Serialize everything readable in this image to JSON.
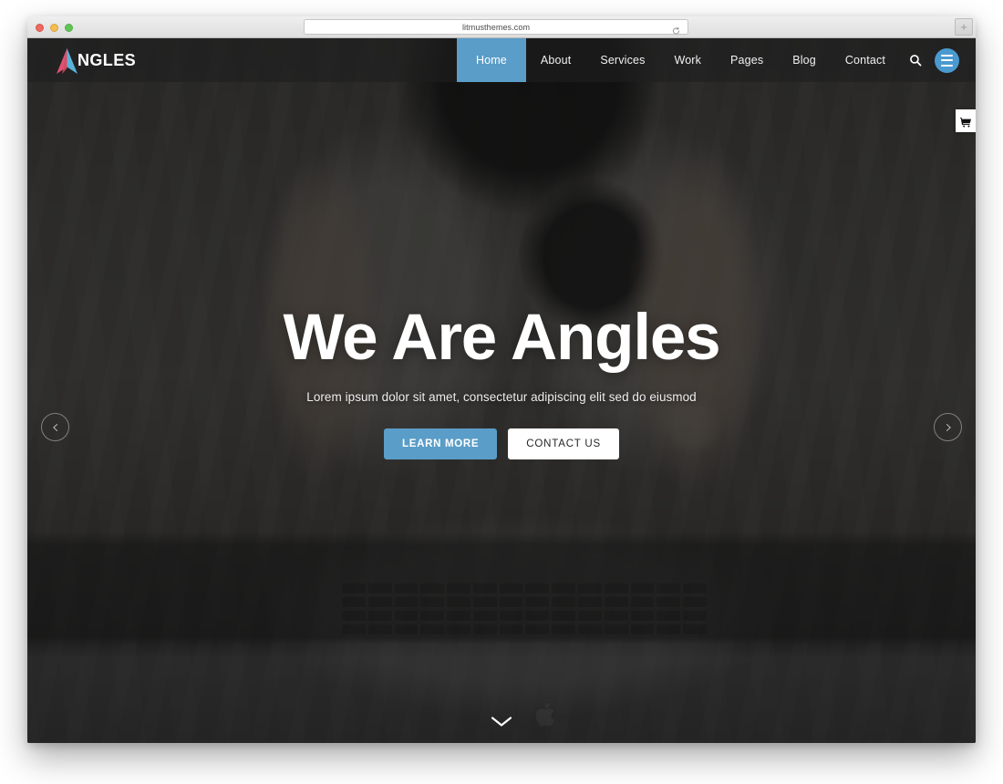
{
  "browser": {
    "url": "litmusthemes.com",
    "reload_icon": "reload-icon",
    "new_tab_label": "+",
    "traffic_lights": [
      "close",
      "minimize",
      "zoom"
    ]
  },
  "site": {
    "brand": {
      "logo_icon": "angles-chevron-logo",
      "name": "NGLES"
    },
    "nav": {
      "items": [
        {
          "label": "Home",
          "active": true
        },
        {
          "label": "About",
          "active": false
        },
        {
          "label": "Services",
          "active": false
        },
        {
          "label": "Work",
          "active": false
        },
        {
          "label": "Pages",
          "active": false
        },
        {
          "label": "Blog",
          "active": false
        },
        {
          "label": "Contact",
          "active": false
        }
      ],
      "search_icon": "search-icon",
      "menu_icon": "hamburger-icon"
    },
    "cart": {
      "icon": "shopping-cart-icon"
    },
    "hero": {
      "title": "We Are Angles",
      "subtitle": "Lorem ipsum dolor sit amet, consectetur adipiscing elit sed do eiusmod",
      "primary_button": "LEARN MORE",
      "secondary_button": "CONTACT US",
      "prev_icon": "chevron-left-icon",
      "next_icon": "chevron-right-icon",
      "scroll_icon": "chevron-down-icon"
    },
    "colors": {
      "accent_blue": "#5a9dc8",
      "menu_blue": "#4a9ad0",
      "logo_pink": "#e0526f",
      "logo_blue": "#5ab4d8",
      "header_overlay": "rgba(30,30,30,.62)"
    }
  }
}
